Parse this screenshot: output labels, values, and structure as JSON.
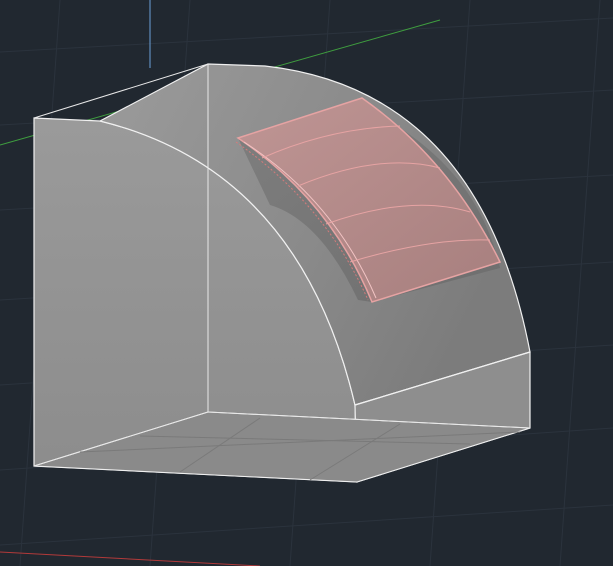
{
  "viewport": {
    "type": "3d-model-viewport",
    "visual_style": "shaded-with-edges",
    "background_color": "#212830",
    "grid_color": "#2b333d",
    "axis_colors": {
      "x": "#b23a3a",
      "y": "#3f9e3f",
      "z": "#6aa0d8"
    }
  },
  "model": {
    "solid_color": "#8f8f8f",
    "edge_color": "#f0f0f0",
    "selected_face_color": "#b98b8a",
    "selected_face_edge_color": "#e6a3a3",
    "selected_face_panels": 4
  }
}
